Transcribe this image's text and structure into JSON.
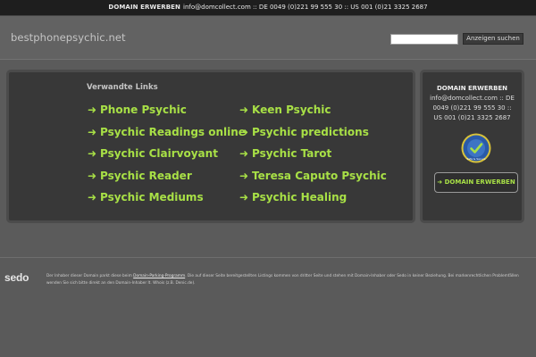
{
  "topbar": {
    "label": "DOMAIN ERWERBEN",
    "contact": "info@domcollect.com :: DE 0049 (0)221 99 555 30 :: US 001 (0)21 3325 2687"
  },
  "header": {
    "site_name": "bestphonepsychic.net",
    "search_placeholder": "",
    "search_button": "Anzeigen suchen"
  },
  "main": {
    "heading": "Verwandte Links",
    "arrow": "➜",
    "columns": [
      [
        "Phone Psychic",
        "Psychic Readings online",
        "Psychic Clairvoyant",
        "Psychic Reader",
        "Psychic Mediums"
      ],
      [
        "Keen Psychic",
        "Psychic predictions",
        "Psychic Tarot",
        "Teresa Caputo Psychic",
        "Psychic Healing"
      ]
    ]
  },
  "sidebar": {
    "title": "DOMAIN ERWERBEN",
    "contact": "info@domcollect.com :: DE 0049 (0)221 99 555 30 :: US 001 (0)21 3325 2687",
    "seal_text": "Safe & Secure",
    "button_label": "DOMAIN ERWERBEN",
    "button_arrow": "➜"
  },
  "footer": {
    "logo": "sedo",
    "text_before_link": "Der Inhaber dieser Domain parkt diese beim ",
    "link_text": "Domain-Parking-Programm",
    "text_after_link": ". Die auf dieser Seite bereitgestellten Listings kommen von dritter Seite und stehen mit Domain-Inhaber oder Sedo in keiner Beziehung. Bei markenrechtlichen Problemfällen wenden Sie sich bitte direkt an den Domain-Inhaber lt. Whois (z.B. Denic.de)."
  },
  "colors": {
    "link": "#a8e046",
    "background": "#5f5f5f",
    "box": "#383838",
    "topbar": "#1e1e1e"
  }
}
